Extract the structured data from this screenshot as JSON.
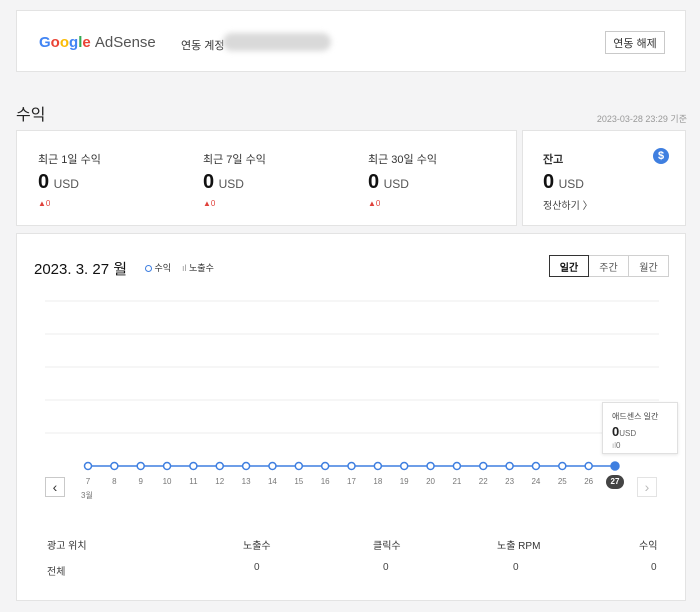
{
  "header": {
    "logo_google": "Google",
    "logo_adsense": "AdSense",
    "linked_account_label": "연동 계정",
    "unlink_button": "연동 해제"
  },
  "earnings": {
    "section_title": "수익",
    "timestamp": "2023-03-28 23:29 기준",
    "cards": [
      {
        "label": "최근 1일 수익",
        "value": "0",
        "unit": "USD",
        "delta": "▲0"
      },
      {
        "label": "최근 7일 수익",
        "value": "0",
        "unit": "USD",
        "delta": "▲0"
      },
      {
        "label": "최근 30일 수익",
        "value": "0",
        "unit": "USD",
        "delta": "▲0"
      }
    ],
    "balance": {
      "label": "잔고",
      "value": "0",
      "unit": "USD",
      "settle_link": "정산하기 〉",
      "dollar_icon": "$"
    }
  },
  "chart_panel": {
    "date_title": "2023. 3. 27 월",
    "legend_revenue": "수익",
    "legend_impressions": "노출수",
    "legend_impressions_icon": "ıl",
    "tabs": [
      "일간",
      "주간",
      "월간"
    ],
    "active_tab": "일간",
    "tooltip": {
      "title": "애드센스 일간",
      "value": "0",
      "unit": "USD",
      "impressions_icon": "ıl",
      "impressions": "0"
    },
    "month_label": "3월",
    "prev_arrow": "‹",
    "next_arrow": "›"
  },
  "chart_data": {
    "type": "line",
    "x": [
      "7",
      "8",
      "9",
      "10",
      "11",
      "12",
      "13",
      "14",
      "15",
      "16",
      "17",
      "18",
      "19",
      "20",
      "21",
      "22",
      "23",
      "24",
      "25",
      "26",
      "27"
    ],
    "series": [
      {
        "name": "수익",
        "values": [
          0,
          0,
          0,
          0,
          0,
          0,
          0,
          0,
          0,
          0,
          0,
          0,
          0,
          0,
          0,
          0,
          0,
          0,
          0,
          0,
          0
        ]
      }
    ],
    "selected": "27",
    "grid": true
  },
  "table": {
    "headers": [
      "광고 위치",
      "노출수",
      "클릭수",
      "노출 RPM",
      "수익"
    ],
    "rows": [
      [
        "전체",
        "0",
        "0",
        "0",
        "0"
      ]
    ]
  },
  "colors": {
    "accent": "#3f7fe0",
    "delta_up": "#e0413b"
  }
}
